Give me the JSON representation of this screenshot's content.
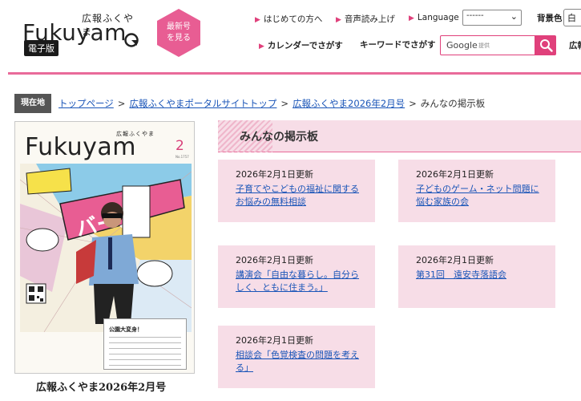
{
  "header": {
    "logo_kana": "広報ふくやま",
    "logo_word": "Fukuyam",
    "logo_badge": "電子版",
    "latest_button": "最新号を見る",
    "nav_beginners": "はじめての方へ",
    "nav_read_aloud": "音声読み上げ",
    "nav_language": "Language",
    "language_value": "------",
    "bg_color_label": "背景色",
    "bg_color_value": "白",
    "nav_calendar": "カレンダーでさがす",
    "keyword_label": "キーワードでさがす",
    "search_brand": "Google",
    "search_placeholder": "提供",
    "wide_link": "広報"
  },
  "breadcrumb": {
    "current_label": "現在地",
    "items": [
      "トップページ",
      "広報ふくやまポータルサイトトップ",
      "広報ふくやま2026年2月号"
    ],
    "current": "みんなの掲示板",
    "separator": ">"
  },
  "cover": {
    "kana": "広報ふくやま",
    "word": "Fukuyam",
    "issue_number": "2",
    "issue_no": "No.1757",
    "box_title": "公園大変身！",
    "caption": "広報ふくやま2026年2月号"
  },
  "page_heading": "みんなの掲示板",
  "cards": [
    {
      "date": "2026年2月1日更新",
      "title": "子育てやこどもの福祉に関するお悩みの無料相談"
    },
    {
      "date": "2026年2月1日更新",
      "title": "子どものゲーム・ネット問題に悩む家族の会"
    },
    {
      "date": "2026年2月1日更新",
      "title": "講演会「自由な暮らし。自分らしく、ともに住まう。」"
    },
    {
      "date": "2026年2月1日更新",
      "title": "第31回　遠安寺落語会"
    },
    {
      "date": "2026年2月1日更新",
      "title": "相談会「色覚検査の問題を考える」"
    }
  ],
  "colors": {
    "brand_pink": "#e0407b",
    "card_bg": "#f7dde7",
    "link_blue": "#1a55b8"
  }
}
